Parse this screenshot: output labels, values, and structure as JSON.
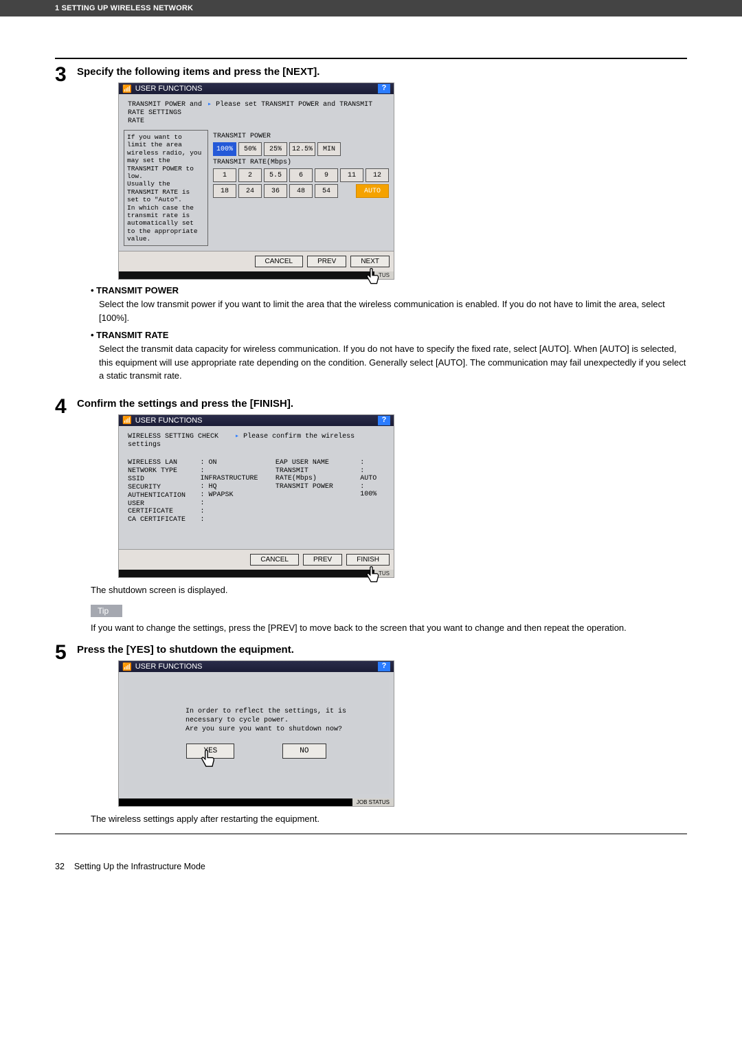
{
  "header": {
    "section": "1 SETTING UP WIRELESS NETWORK"
  },
  "step3": {
    "num": "3",
    "title": "Specify the following items and press the [NEXT].",
    "ss_title": "USER FUNCTIONS",
    "instruction_left": "TRANSMIT POWER and\nRATE SETTINGS",
    "instruction_right": "Please set TRANSMIT POWER and TRANSMIT RATE",
    "leftbox": "If you want to limit the area wireless radio, you may set the TRANSMIT POWER to low.\nUsually the TRANSMIT RATE is set to \"Auto\".\nIn which case the transmit rate is automatically set to the appropriate value.",
    "power_label": "TRANSMIT POWER",
    "power_opts": [
      "100%",
      "50%",
      "25%",
      "12.5%",
      "MIN"
    ],
    "rate_label": "TRANSMIT RATE(Mbps)",
    "rate_row1": [
      "1",
      "2",
      "5.5",
      "6",
      "9",
      "11",
      "12"
    ],
    "rate_row2": [
      "18",
      "24",
      "36",
      "48",
      "54"
    ],
    "rate_auto": "AUTO",
    "cancel": "CANCEL",
    "prev": "PREV",
    "next": "NEXT",
    "status": "TUS",
    "bullets": [
      {
        "h": "TRANSMIT POWER",
        "p": "Select the low transmit power if you want to limit the area that the wireless communication is enabled.  If you do not have to limit the area, select [100%]."
      },
      {
        "h": "TRANSMIT RATE",
        "p": "Select the transmit data capacity for wireless communication.  If you do not have to specify the fixed rate, select [AUTO].  When [AUTO] is selected, this equipment will use appropriate rate depending on the condition.  Generally select [AUTO].  The communication may fail unexpectedly if you select a static transmit rate."
      }
    ]
  },
  "step4": {
    "num": "4",
    "title": "Confirm the settings and press the [FINISH].",
    "ss_title": "USER FUNCTIONS",
    "check_label": "WIRELESS SETTING CHECK",
    "check_instr": "Please confirm the wireless settings",
    "left_labels": [
      "WIRELESS LAN",
      "NETWORK TYPE",
      "SSID",
      "SECURITY",
      "AUTHENTICATION",
      "USER CERTIFICATE",
      "CA CERTIFICATE"
    ],
    "left_vals": [
      ": ON",
      ": INFRASTRUCTURE",
      ": HQ",
      ": WPAPSK",
      ":",
      ":",
      ":"
    ],
    "right_labels": [
      "EAP USER NAME",
      "TRANSMIT RATE(Mbps)",
      "TRANSMIT POWER"
    ],
    "right_vals": [
      ":",
      ": AUTO",
      ": 100%"
    ],
    "cancel": "CANCEL",
    "prev": "PREV",
    "finish": "FINISH",
    "status": "TUS",
    "after": "The shutdown screen is displayed.",
    "tip_label": "Tip",
    "tip_text": "If you want to change the settings, press the [PREV] to move back to the screen that you want to change and then repeat the operation."
  },
  "step5": {
    "num": "5",
    "title": "Press the [YES] to shutdown the equipment.",
    "ss_title": "USER FUNCTIONS",
    "msg": "In order to reflect the settings, it is\nnecessary to cycle power.\nAre you sure you want to shutdown now?",
    "yes": "YES",
    "no": "NO",
    "jobstatus": "JOB STATUS",
    "after": "The wireless settings apply after restarting the equipment."
  },
  "footer": {
    "pagenum": "32",
    "title": "Setting Up the Infrastructure Mode"
  }
}
